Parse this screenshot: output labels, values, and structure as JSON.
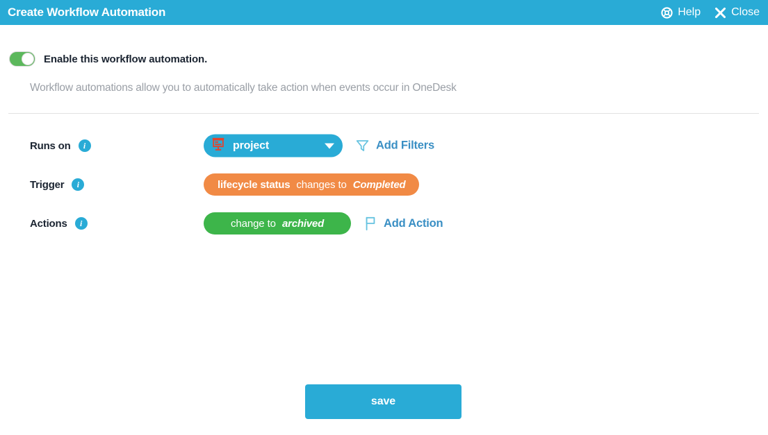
{
  "header": {
    "title": "Create Workflow Automation",
    "help_label": "Help",
    "help_icon": "lifebuoy-icon",
    "close_label": "Close",
    "close_icon": "close-x-icon",
    "background_color": "#29abd6"
  },
  "enable": {
    "label": "Enable this workflow automation.",
    "toggle_state": "on",
    "toggle_color": "#5cb85c"
  },
  "description": "Workflow automations allow you to automatically take action when events occur in OneDesk",
  "rows": {
    "runs_on": {
      "label": "Runs on",
      "info_icon": "info-icon",
      "selected_value": "project",
      "item_icon": "project-board-icon",
      "item_icon_color": "#e2442f",
      "pill_color": "#29abd6",
      "add_filters_label": "Add Filters",
      "add_filters_icon": "filter-funnel-icon"
    },
    "trigger": {
      "label": "Trigger",
      "info_icon": "info-icon",
      "pill_color": "#f18a45",
      "field": "lifecycle status",
      "operator": "changes to",
      "value": "Completed"
    },
    "actions": {
      "label": "Actions",
      "info_icon": "info-icon",
      "pill_color": "#3db54a",
      "operator": "change to",
      "value": "archived",
      "add_action_label": "Add Action",
      "add_action_icon": "flag-icon"
    }
  },
  "footer": {
    "save_label": "save",
    "save_color": "#29abd6"
  }
}
